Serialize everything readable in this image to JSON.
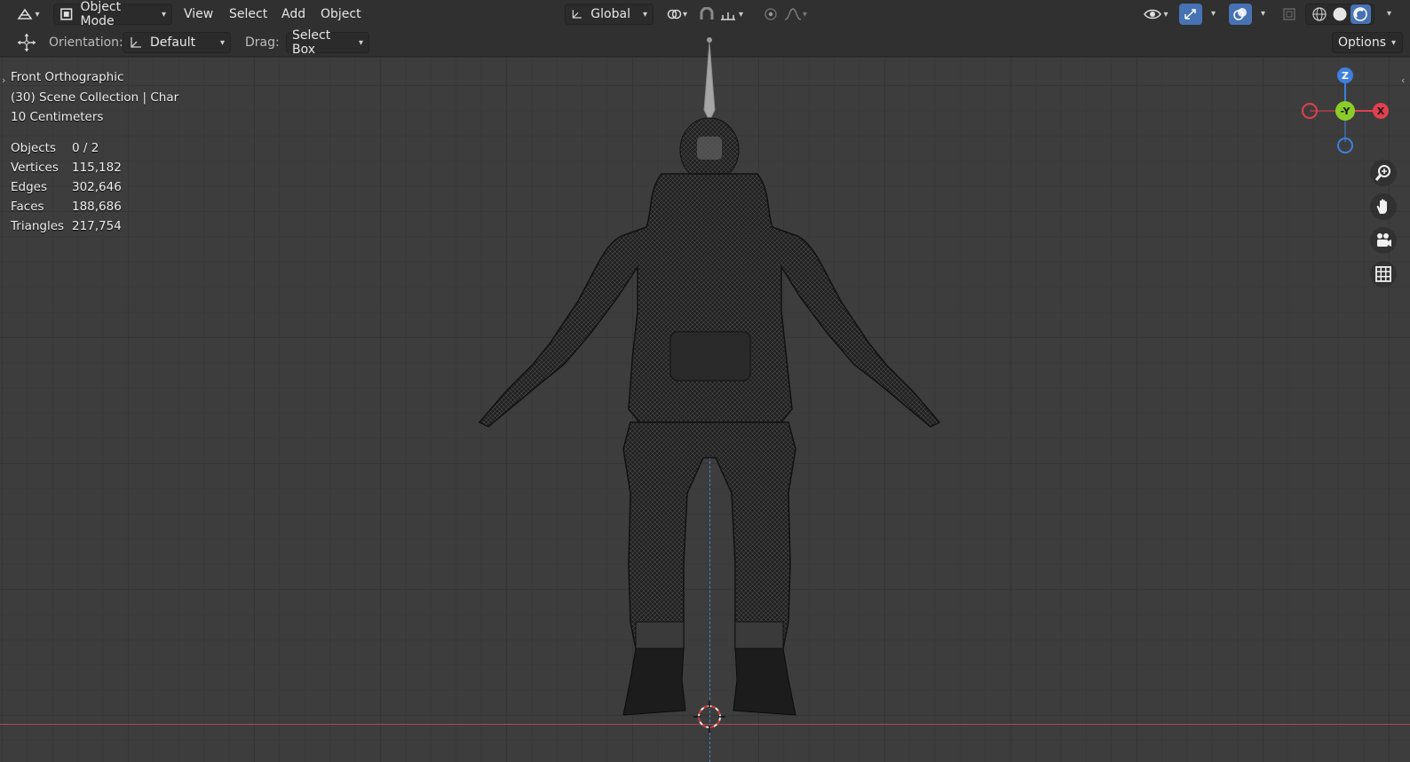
{
  "header": {
    "editor_type_icon": "editor-type-icon",
    "mode": {
      "label": "Object Mode",
      "icon": "object-mode-icon"
    },
    "menus": [
      "View",
      "Select",
      "Add",
      "Object"
    ],
    "transform_orientation": {
      "label": "Global",
      "icon": "transform-orientation-icon"
    },
    "pivot_icon": "pivot-point-icon",
    "snap_icons": [
      "snap-magnet-icon",
      "snap-increment-icon"
    ],
    "proportional_icons": [
      "proportional-edit-icon",
      "falloff-curve-icon"
    ],
    "right_icons": [
      "visibility-eye-icon",
      "gizmo-toggle-icon",
      "overlay-toggle-icon",
      "xray-icon",
      "wireframe-shading-icon",
      "solid-shading-icon",
      "material-shading-icon"
    ]
  },
  "toolbar": {
    "transform_icon": "move-tool-icon",
    "orientation_label": "Orientation:",
    "orientation_value": "Default",
    "drag_label": "Drag:",
    "drag_value": "Select Box",
    "options_label": "Options"
  },
  "viewport": {
    "view_name": "Front Orthographic",
    "collection": "(30) Scene Collection | Char",
    "scale": "10 Centimeters",
    "stats": [
      {
        "key": "Objects",
        "value": "0 / 2"
      },
      {
        "key": "Vertices",
        "value": "115,182"
      },
      {
        "key": "Edges",
        "value": "302,646"
      },
      {
        "key": "Faces",
        "value": "188,686"
      },
      {
        "key": "Triangles",
        "value": "217,754"
      }
    ]
  },
  "gizmo": {
    "z_label": "Z",
    "y_label": "-Y",
    "x_label": "X",
    "colors": {
      "x": "#e0404f",
      "y": "#8ccc28",
      "z": "#3f7fe0"
    }
  },
  "nav_buttons": [
    "zoom-icon",
    "pan-hand-icon",
    "camera-view-icon",
    "ortho-grid-icon"
  ],
  "colors": {
    "accent": "#4772b3",
    "background": "#303030",
    "viewport": "#3d3d3d"
  }
}
